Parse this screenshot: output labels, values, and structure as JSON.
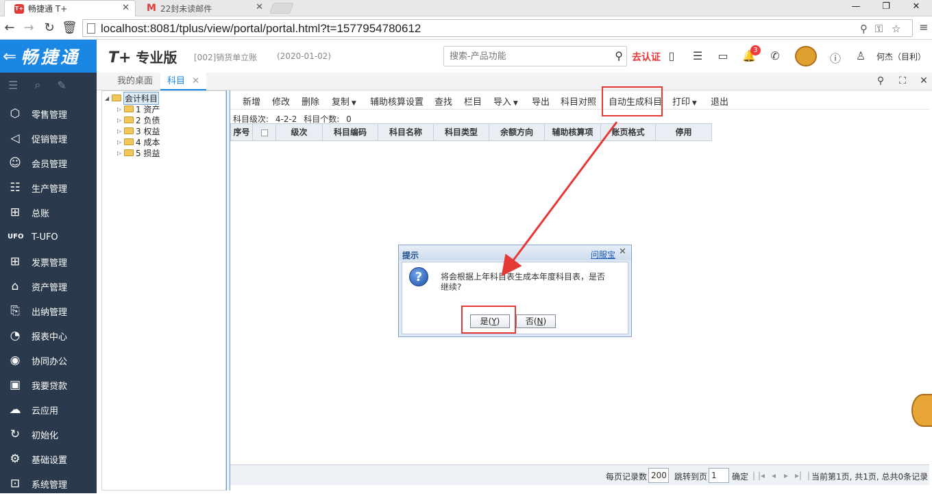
{
  "browser": {
    "tabs": [
      {
        "label": "畅捷通 T+",
        "favicon_text": "T+",
        "favicon_color": "#e53935",
        "active": true
      },
      {
        "label": "22封未读邮件",
        "favicon_text": "M",
        "favicon_color": "#e53935",
        "active": false
      }
    ],
    "url": "localhost:8081/tplus/view/portal/portal.html?t=1577954780612"
  },
  "header": {
    "brand": "畅捷通",
    "product": "专业版",
    "product_prefix": "T+",
    "account": "[002]销货单立账",
    "date": "(2020-01-02)",
    "search_placeholder": "搜索-产品功能",
    "certify_label": "去认证",
    "notification_count": "3",
    "username": "何杰（目利）"
  },
  "sidebar": {
    "items": [
      {
        "label": "零售管理",
        "icon": "retail-icon"
      },
      {
        "label": "促销管理",
        "icon": "megaphone-icon"
      },
      {
        "label": "会员管理",
        "icon": "member-card-icon"
      },
      {
        "label": "生产管理",
        "icon": "production-icon"
      },
      {
        "label": "总账",
        "icon": "ledger-icon"
      },
      {
        "label": "T-UFO",
        "icon": "ufo-icon"
      },
      {
        "label": "发票管理",
        "icon": "invoice-icon"
      },
      {
        "label": "资产管理",
        "icon": "bank-icon"
      },
      {
        "label": "出纳管理",
        "icon": "cashier-icon"
      },
      {
        "label": "报表中心",
        "icon": "pie-chart-icon"
      },
      {
        "label": "协同办公",
        "icon": "collaboration-icon"
      },
      {
        "label": "我要贷款",
        "icon": "money-icon"
      },
      {
        "label": "云应用",
        "icon": "cloud-icon"
      },
      {
        "label": "初始化",
        "icon": "refresh-icon"
      },
      {
        "label": "基础设置",
        "icon": "settings-icon"
      },
      {
        "label": "系统管理",
        "icon": "system-icon"
      }
    ]
  },
  "content_tabs": [
    {
      "label": "我的桌面",
      "active": false
    },
    {
      "label": "科目",
      "active": true
    }
  ],
  "tree": {
    "root": "会计科目",
    "children": [
      "1 资产",
      "2 负债",
      "3 权益",
      "4 成本",
      "5 损益"
    ]
  },
  "toolbar": {
    "buttons": [
      "新增",
      "修改",
      "删除",
      "复制",
      "辅助核算设置",
      "查找",
      "栏目",
      "导入",
      "导出",
      "科目对照",
      "自动生成科目",
      "打印",
      "退出"
    ]
  },
  "level_info": {
    "label": "科目级次:",
    "value": "4-2-2",
    "count_label": "科目个数:",
    "count": "0"
  },
  "grid": {
    "columns": [
      "序号",
      "",
      "级次",
      "科目编码",
      "科目名称",
      "科目类型",
      "余额方向",
      "辅助核算项",
      "账页格式",
      "停用"
    ]
  },
  "pager": {
    "per_page_label": "每页记录数",
    "per_page": "200",
    "jump_label": "跳转到页",
    "jump_value": "1",
    "confirm_label": "确定",
    "status": "当前第1页, 共1页, 总共0条记录"
  },
  "dialog": {
    "title": "提示",
    "help_link": "问服宝",
    "message": "将会根据上年科目表生成本年度科目表，是否继续?",
    "yes_label": "是(",
    "yes_key": "Y",
    "no_label": "否(",
    "no_key": "N"
  },
  "colors": {
    "brand_blue": "#1a87e5",
    "sidebar_bg": "#2a3a4c",
    "highlight_red": "#e53935"
  }
}
